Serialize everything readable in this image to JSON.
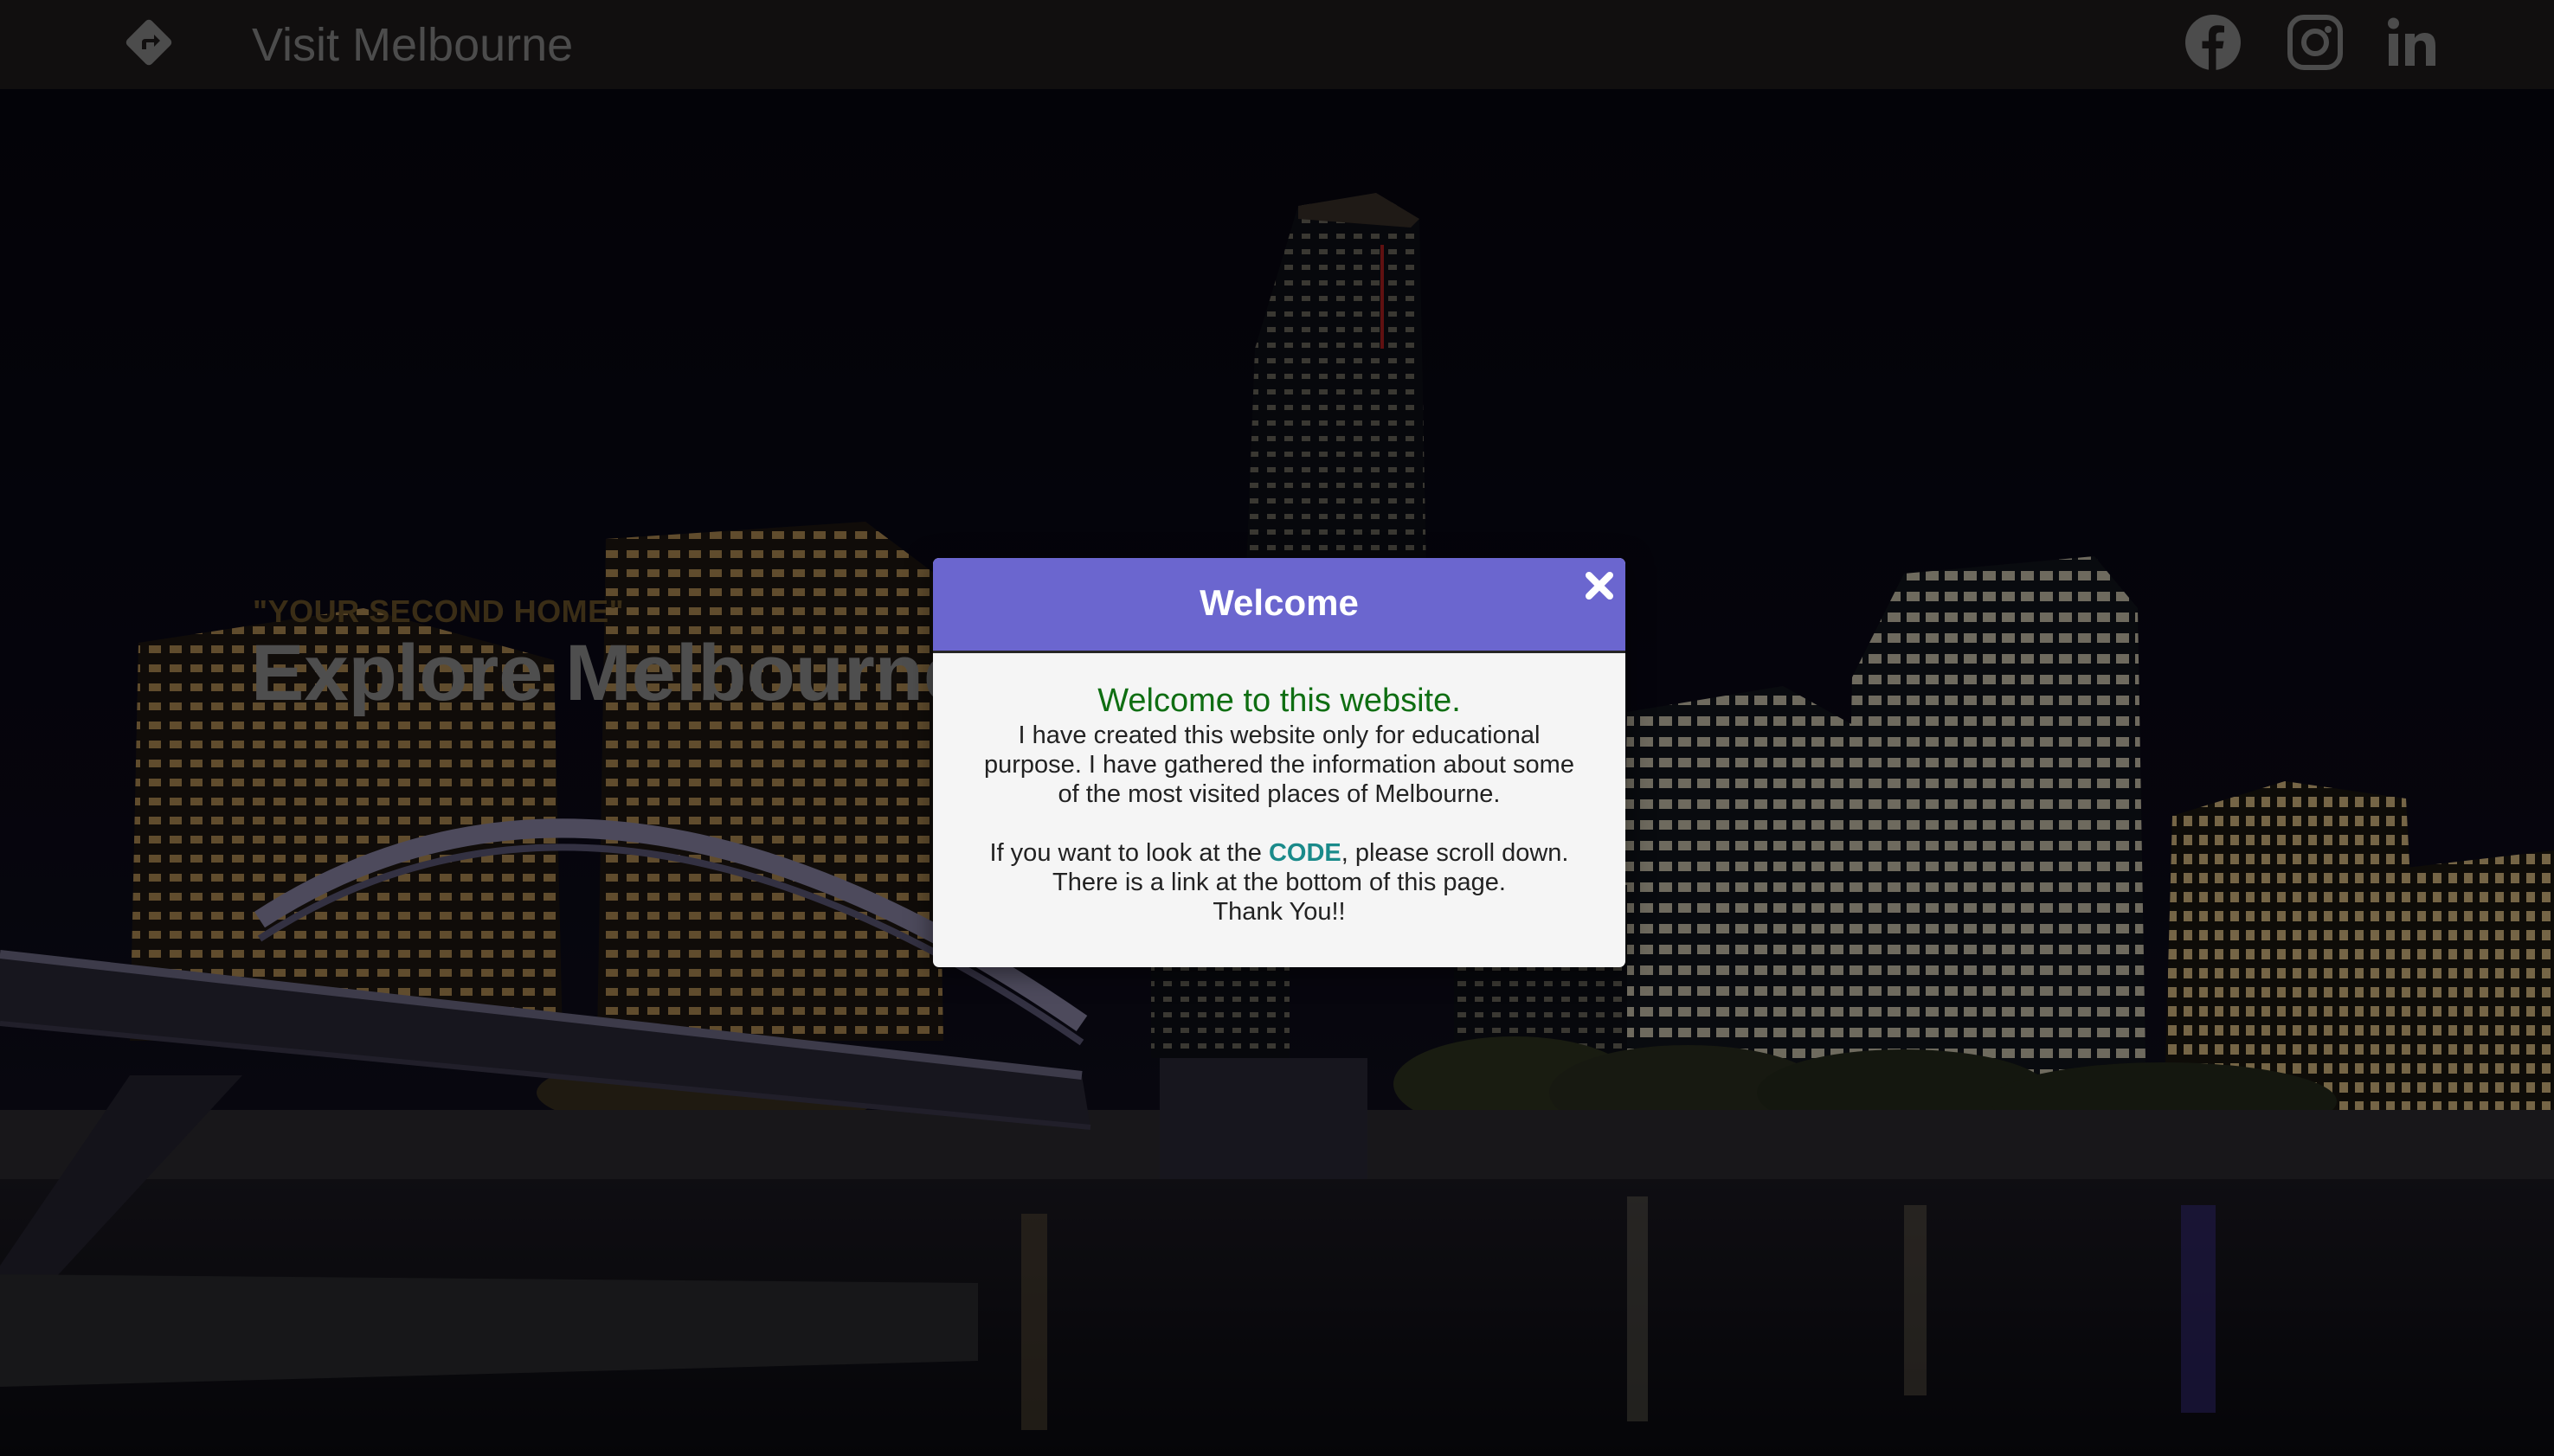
{
  "nav": {
    "brand": "Visit Melbourne",
    "logo_icon": "directions-diamond-icon",
    "social": [
      {
        "name": "facebook",
        "icon": "facebook-icon"
      },
      {
        "name": "instagram",
        "icon": "instagram-icon"
      },
      {
        "name": "linkedin",
        "icon": "linkedin-icon"
      }
    ]
  },
  "hero": {
    "tagline": "\"YOUR SECOND HOME\"",
    "title": "Explore Melbourne"
  },
  "modal": {
    "title": "Welcome",
    "close_icon": "close-icon",
    "heading": "Welcome to this website.",
    "lines": [
      "I have created this website only for educational",
      "purpose. I have gathered the information about some",
      "of the most visited places of Melbourne."
    ],
    "code_prefix": "If you want to look at the ",
    "code_link": "CODE",
    "code_suffix": ", please scroll down.",
    "line_link": "There is a link at the bottom of this page.",
    "thanks": "Thank You!!"
  },
  "colors": {
    "navbar_bg": "#1f1c1c",
    "modal_header": "#6b66cf",
    "welcome_green": "#0f6e12",
    "code_teal": "#1a8a8a",
    "tagline_gold": "#6a5228"
  }
}
